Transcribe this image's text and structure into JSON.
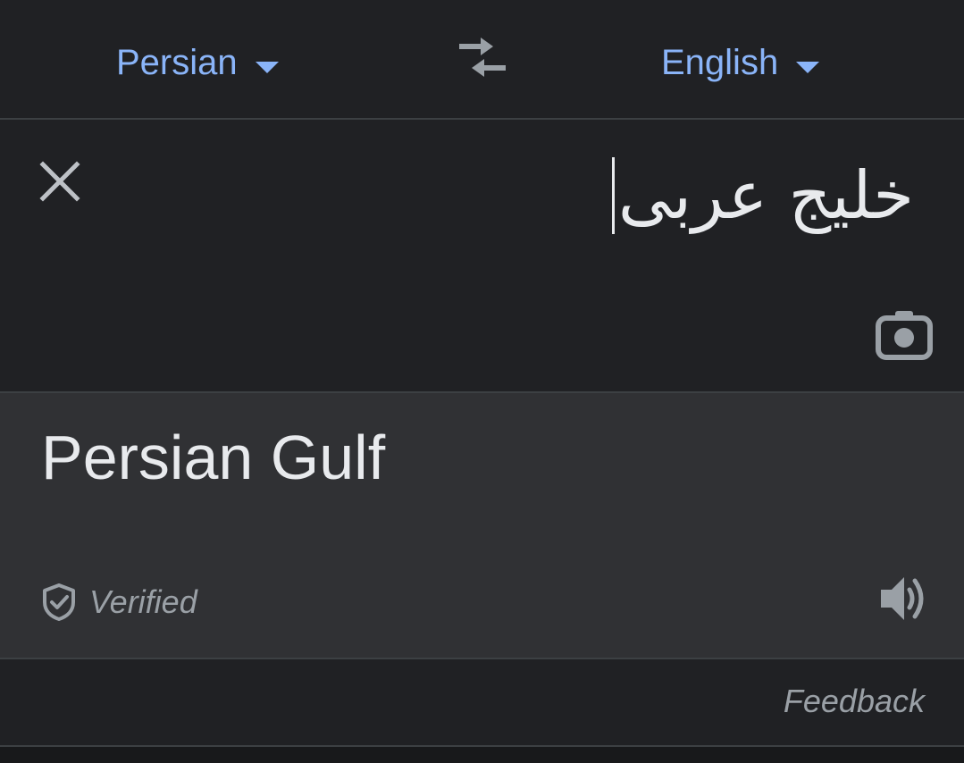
{
  "language_bar": {
    "source_language": "Persian",
    "target_language": "English",
    "swap_icon": "swap-arrows-icon"
  },
  "input": {
    "text": "خلیج عربی",
    "clear_icon": "close-icon",
    "camera_icon": "camera-icon"
  },
  "output": {
    "text": "Persian Gulf",
    "verified_label": "Verified",
    "verified_icon": "shield-check-icon",
    "speaker_icon": "speaker-icon"
  },
  "footer": {
    "feedback_label": "Feedback"
  },
  "colors": {
    "background": "#202124",
    "output_background": "#303134",
    "accent": "#8ab4f8",
    "text_primary": "#e8eaed",
    "text_secondary": "#9aa0a6"
  }
}
